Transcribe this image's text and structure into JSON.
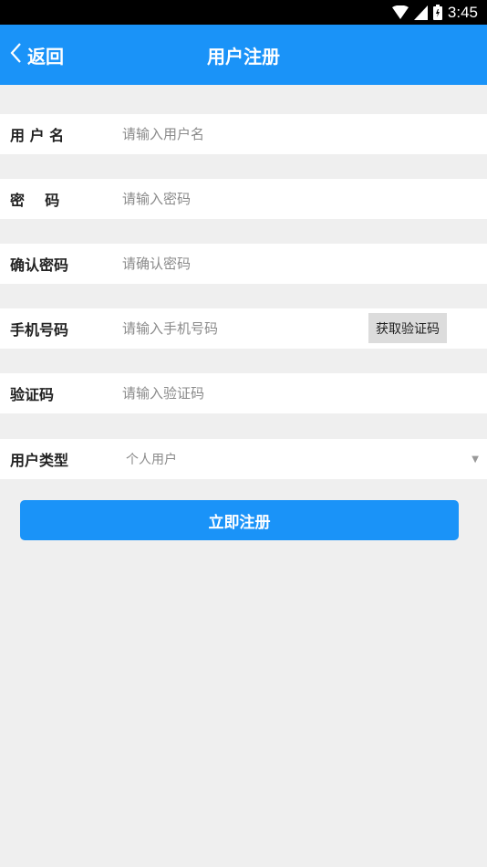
{
  "status_bar": {
    "time": "3:45",
    "icons": [
      "wifi-icon",
      "signal-icon",
      "battery-icon"
    ]
  },
  "header": {
    "back_label": "返回",
    "title": "用户注册",
    "color": "#1a93f8"
  },
  "form": {
    "username": {
      "label": "用 户 名",
      "placeholder": "请输入用户名"
    },
    "password": {
      "label": "密    码",
      "placeholder": "请输入密码"
    },
    "confirm_password": {
      "label": "确认密码",
      "placeholder": "请确认密码"
    },
    "phone": {
      "label": "手机号码",
      "placeholder": "请输入手机号码",
      "code_button": "获取验证码"
    },
    "code": {
      "label": "验证码",
      "placeholder": "请输入验证码"
    },
    "user_type": {
      "label": "用户类型",
      "selected": "个人用户"
    }
  },
  "submit_label": "立即注册"
}
